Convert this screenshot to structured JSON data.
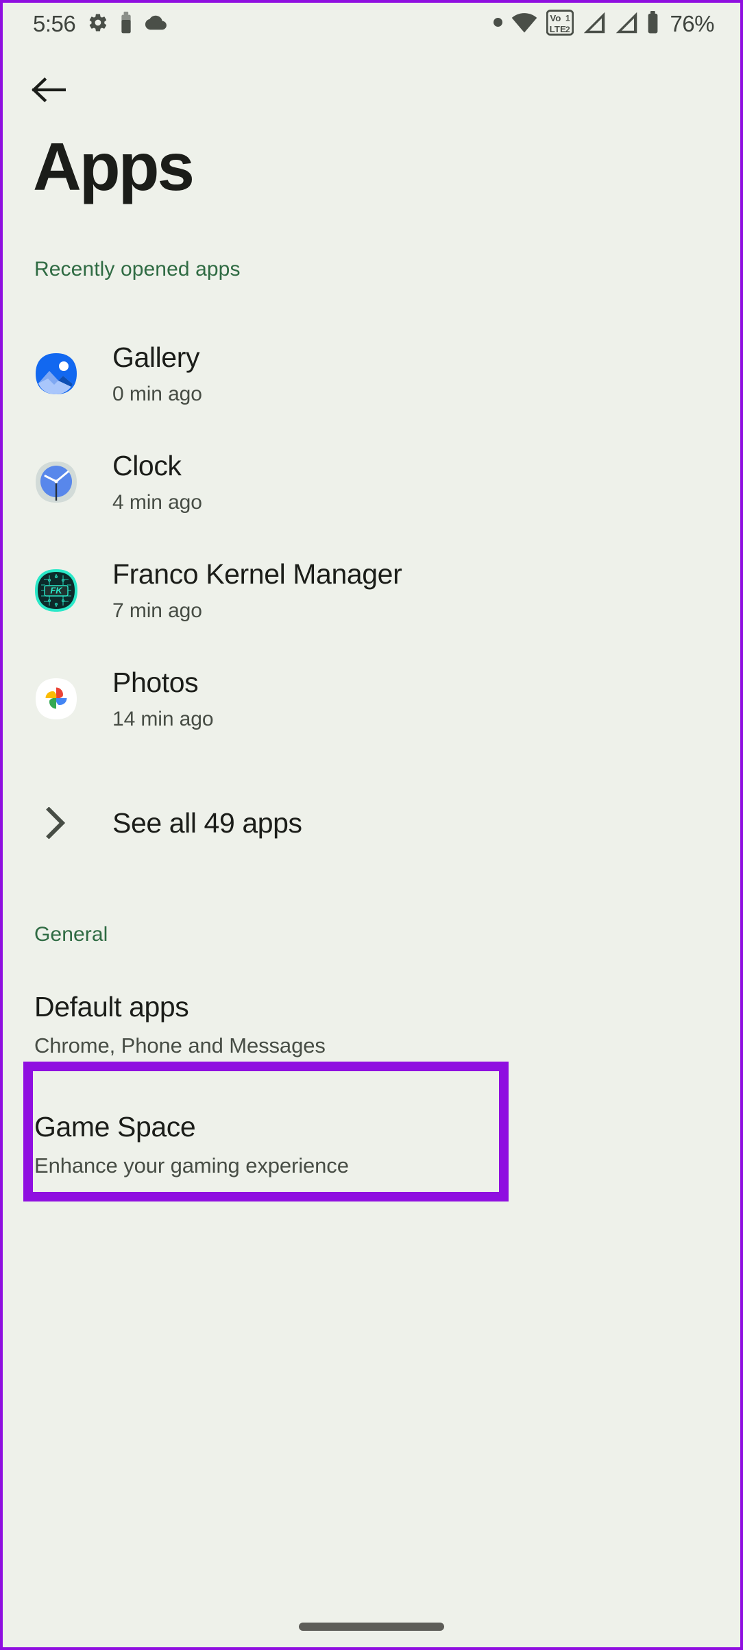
{
  "status_bar": {
    "time": "5:56",
    "battery_percent": "76%",
    "left_icons": [
      "gear-icon",
      "battery-saver-icon",
      "cloud-icon"
    ],
    "right_icons": [
      "dot-icon",
      "wifi-icon",
      "volte-dual-sim-icon",
      "signal-sim1-icon",
      "signal-sim2-icon",
      "battery-icon"
    ],
    "volte_label_top": "Vo",
    "volte_label_bottom": "LTE",
    "volte_sim1": "1",
    "volte_sim2": "2"
  },
  "nav": {
    "back_icon": "arrow-left-icon"
  },
  "header": {
    "title": "Apps"
  },
  "recent_section": {
    "header": "Recently opened apps",
    "apps": [
      {
        "name": "Gallery",
        "time": "0 min ago",
        "icon": "gallery-icon"
      },
      {
        "name": "Clock",
        "time": "4 min ago",
        "icon": "clock-icon"
      },
      {
        "name": "Franco Kernel Manager",
        "time": "7 min ago",
        "icon": "franco-kernel-manager-icon"
      },
      {
        "name": "Photos",
        "time": "14 min ago",
        "icon": "google-photos-icon"
      }
    ],
    "see_all": {
      "label": "See all 49 apps",
      "app_count": "49",
      "icon": "chevron-right-icon",
      "highlighted": true,
      "highlight_color": "#8f0fe0"
    }
  },
  "general_section": {
    "header": "General",
    "items": [
      {
        "title": "Default apps",
        "subtitle": "Chrome, Phone and Messages"
      },
      {
        "title": "Game Space",
        "subtitle": "Enhance your gaming experience"
      }
    ]
  },
  "system_nav": {
    "pill": "gesture-nav-pill"
  },
  "colors": {
    "background": "#eef1ea",
    "accent_green": "#2f6b43",
    "highlight_purple": "#8f0fe0",
    "primary_text": "#1b1d19",
    "secondary_text": "#474d45"
  }
}
